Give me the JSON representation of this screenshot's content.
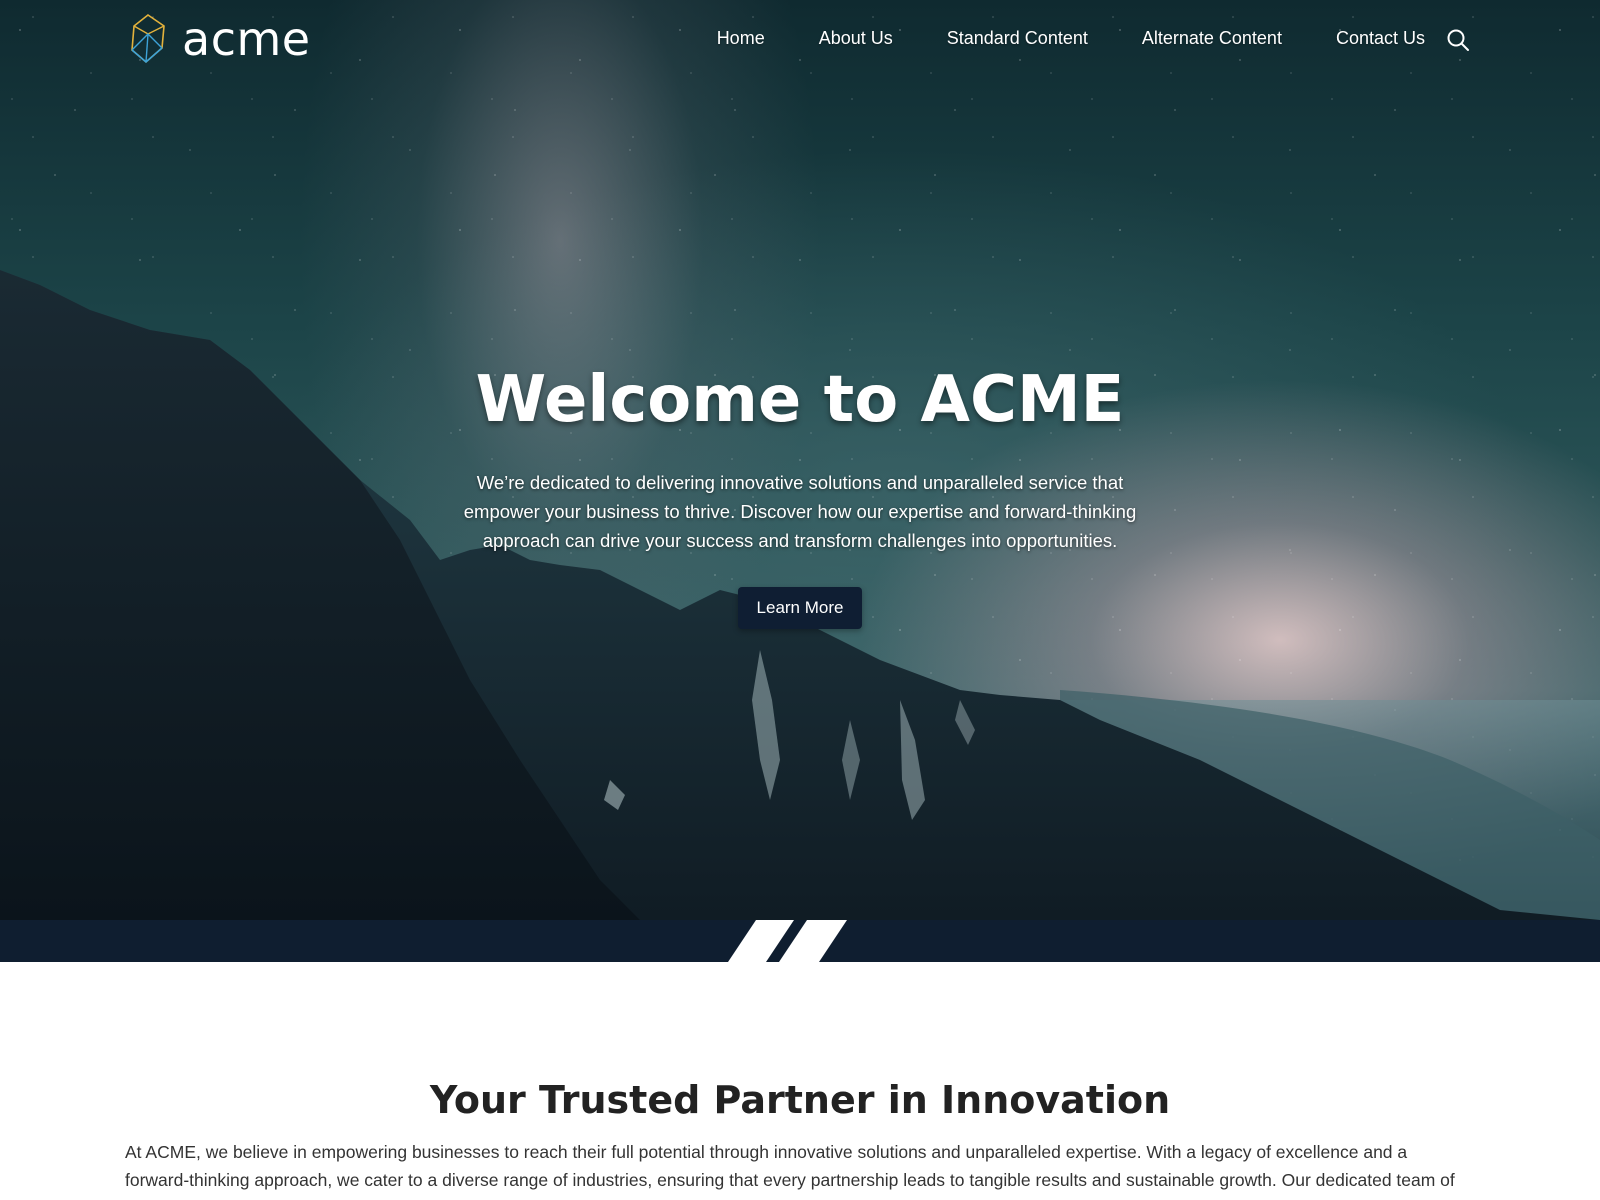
{
  "brand": {
    "name": "acme",
    "logo_icon": "polyhedron-logo-icon"
  },
  "nav": {
    "items": [
      {
        "label": "Home"
      },
      {
        "label": "About Us"
      },
      {
        "label": "Standard Content"
      },
      {
        "label": "Alternate Content"
      },
      {
        "label": "Contact Us"
      }
    ],
    "search_icon": "search-icon"
  },
  "hero": {
    "title": "Welcome to ACME",
    "text": "We’re dedicated to delivering innovative solutions and unparalleled service that empower your business to thrive. Discover how our expertise and forward-thinking approach can drive your success and transform challenges into opportunities.",
    "cta_label": "Learn More",
    "background": "night-sky-mountains-photo"
  },
  "intro": {
    "title": "Your Trusted Partner in Innovation",
    "text": "At ACME, we believe in empowering businesses to reach their full potential through innovative solutions and unparalleled expertise. With a legacy of excellence and a forward-thinking approach, we cater to a diverse range of industries, ensuring that every partnership leads to tangible results and sustainable growth. Our dedicated team of"
  },
  "colors": {
    "navy": "#0f1e30",
    "button": "#0f1e33",
    "heading": "#222222",
    "body_text": "#333333"
  }
}
